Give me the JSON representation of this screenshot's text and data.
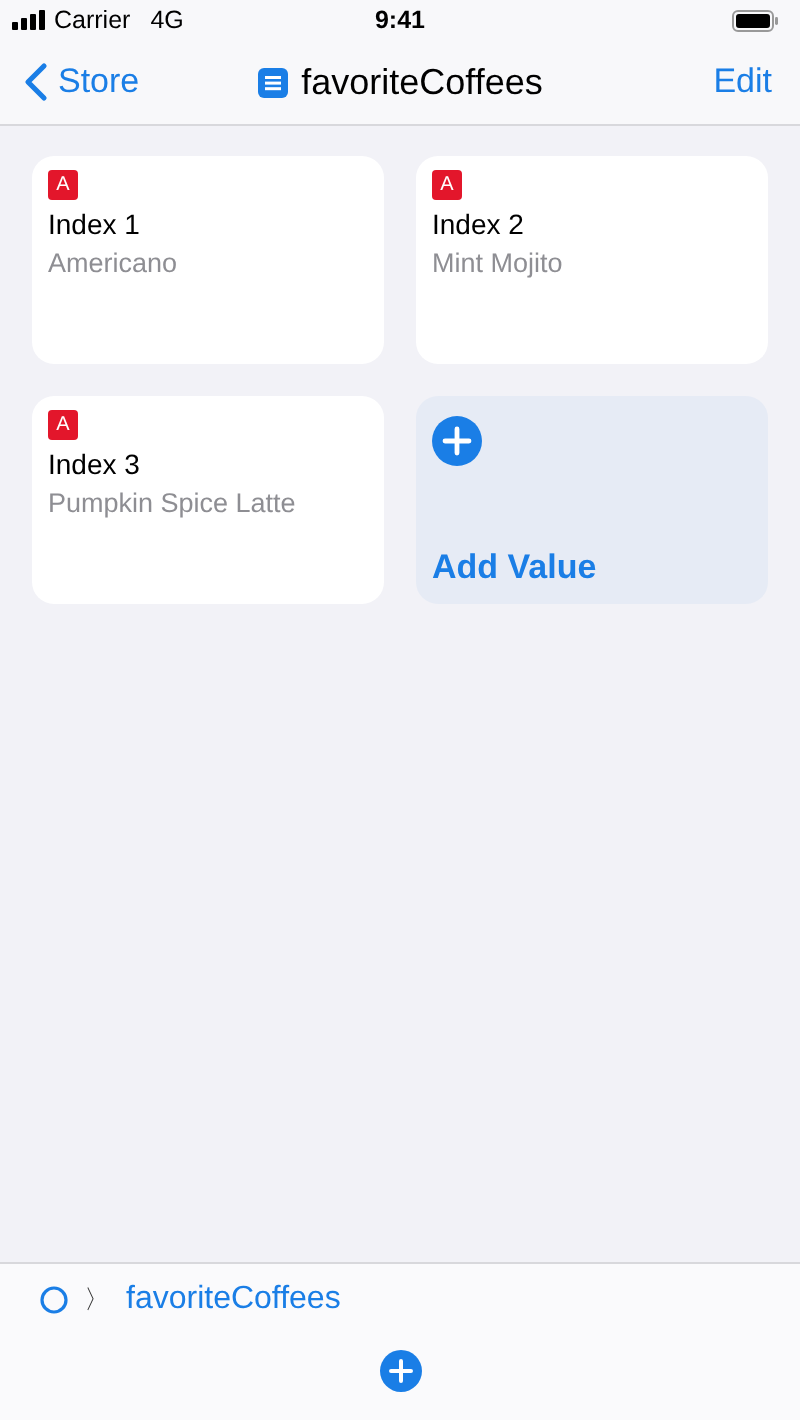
{
  "status_bar": {
    "carrier": "Carrier",
    "network": "4G",
    "time": "9:41"
  },
  "nav_bar": {
    "back": "Store",
    "title": "favoriteCoffees",
    "action": "Edit"
  },
  "items": [
    {
      "badge": "A",
      "title": "Index 1",
      "value": "Americano"
    },
    {
      "badge": "A",
      "title": "Index 2",
      "value": "Mint Mojito"
    },
    {
      "badge": "A",
      "title": "Index 3",
      "value": "Pumpkin Spice Latte"
    }
  ],
  "add_card": {
    "label": "Add Value"
  },
  "path_bar": {
    "separator": "〉",
    "crumb": "favoriteCoffees"
  }
}
